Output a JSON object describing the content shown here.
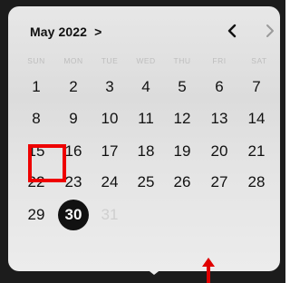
{
  "header": {
    "month_label": "May 2022",
    "month_chevron": ">",
    "prev_icon": "chevron-left-icon",
    "next_icon": "chevron-right-icon"
  },
  "weekdays": [
    "SUN",
    "MON",
    "TUE",
    "WED",
    "THU",
    "FRI",
    "SAT"
  ],
  "weeks": [
    [
      "1",
      "2",
      "3",
      "4",
      "5",
      "6",
      "7"
    ],
    [
      "8",
      "9",
      "10",
      "11",
      "12",
      "13",
      "14"
    ],
    [
      "15",
      "16",
      "17",
      "18",
      "19",
      "20",
      "21"
    ],
    [
      "22",
      "23",
      "24",
      "25",
      "26",
      "27",
      "28"
    ],
    [
      "29",
      "30",
      "31"
    ]
  ],
  "selected_day": "30",
  "muted_days": [
    "31"
  ],
  "highlighted_day": "15",
  "colors": {
    "highlight_box": "#e00000",
    "annotation_arrow": "#e00000",
    "selected_bg": "#111111"
  }
}
